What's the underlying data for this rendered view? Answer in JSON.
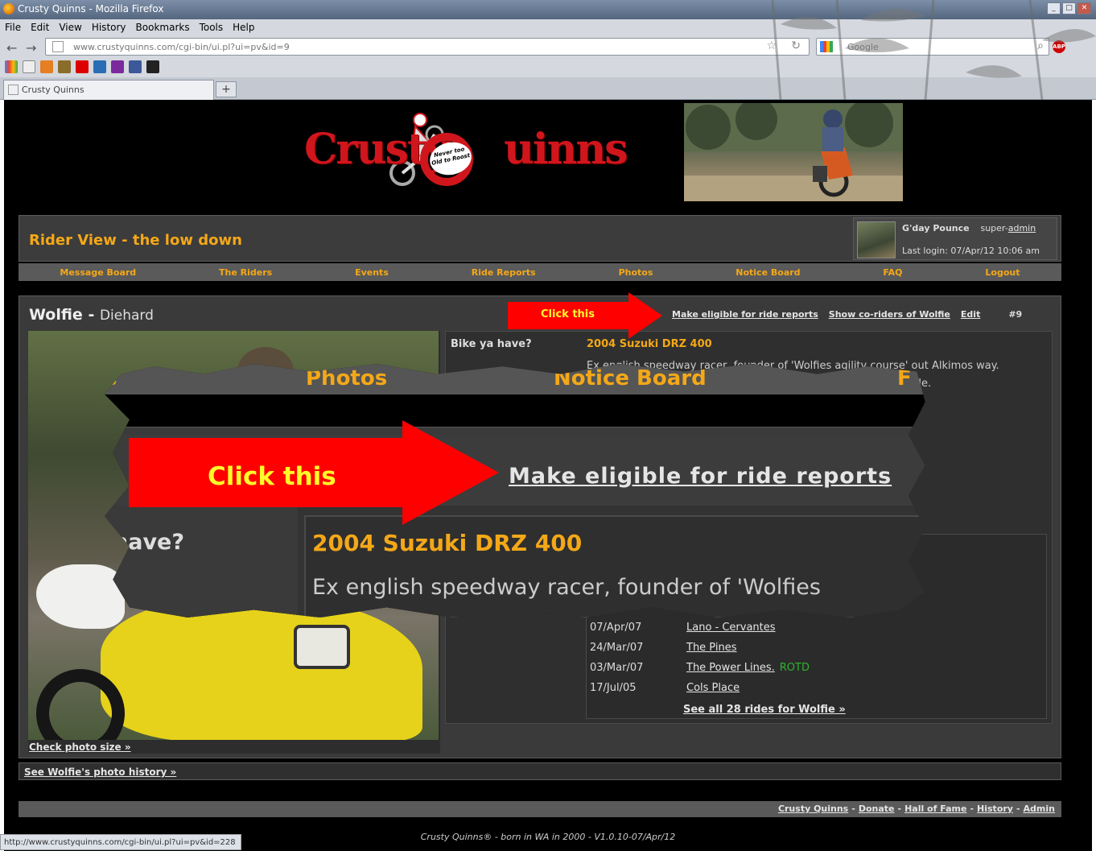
{
  "browser": {
    "window_title": "Crusty Quinns - Mozilla Firefox",
    "menu": [
      "File",
      "Edit",
      "View",
      "History",
      "Bookmarks",
      "Tools",
      "Help"
    ],
    "url": "www.crustyquinns.com/cgi-bin/ui.pl?ui=pv&id=9",
    "search_placeholder": "Google",
    "tab_title": "Crusty Quinns",
    "new_tab": "+",
    "status_url": "http://www.crustyquinns.com/cgi-bin/ui.pl?ui=pv&id=228"
  },
  "logo": {
    "text": "CrustyQuinns",
    "bubble": "Never too Old to Roost"
  },
  "header": {
    "title": "Rider View - the low down",
    "greeting": "G'day Pounce",
    "role_prefix": "super-",
    "role_link": "admin",
    "last_login": "Last login: 07/Apr/12 10:06 am"
  },
  "nav": [
    "Message Board",
    "The Riders",
    "Events",
    "Ride Reports",
    "Photos",
    "Notice Board",
    "FAQ",
    "Logout"
  ],
  "rider": {
    "name": "Wolfie",
    "separator": " - ",
    "rank": "Diehard",
    "links": {
      "eligible": "Make eligible for ride reports",
      "co_riders": "Show co-riders of Wolfie",
      "edit": "Edit",
      "number": "#9"
    },
    "check_photo": "Check photo size »",
    "bike_label": "Bike ya have?",
    "bike_value": "2004 Suzuki DRZ 400",
    "bio_line1": "Ex english speedway racer, founder of 'Wolfies agility course' out Alkimos way.",
    "bio_line2": "...le."
  },
  "rides": [
    {
      "date": "07/Apr/07",
      "name": "Lano - Cervantes",
      "tag": ""
    },
    {
      "date": "24/Mar/07",
      "name": "The Pines",
      "tag": ""
    },
    {
      "date": "03/Mar/07",
      "name": "The Power Lines.",
      "tag": "ROTD"
    },
    {
      "date": "17/Jul/05",
      "name": "Cols Place",
      "tag": ""
    }
  ],
  "see_all_rides": "See all 28 rides for Wolfie »",
  "photo_history": "See Wolfie's photo history »",
  "footer_links": [
    "Crusty Quinns",
    "Donate",
    "Hall of Fame",
    "History",
    "Admin"
  ],
  "copyright": "Crusty Quinns® - born in WA in 2000 - V1.0.10-07/Apr/12",
  "callout": {
    "small_label": "Click this",
    "big_label": "Click this",
    "zoom_nav_left": "s",
    "zoom_nav_photos": "Photos",
    "zoom_nav_notice": "Notice Board",
    "zoom_nav_right": "F",
    "zoom_link": "Make eligible for ride reports",
    "zoom_have": "have?",
    "zoom_bike": "2004 Suzuki DRZ 400",
    "zoom_bio": "Ex english speedway racer, founder of 'Wolfies"
  },
  "colors": {
    "accent": "#f4a818",
    "brand_red": "#d0161c",
    "arrow_red": "#ff0000",
    "arrow_text": "#fffa2a",
    "background": "#000000",
    "panel": "#3a3a3a",
    "rotd_green": "#2ab52a"
  }
}
